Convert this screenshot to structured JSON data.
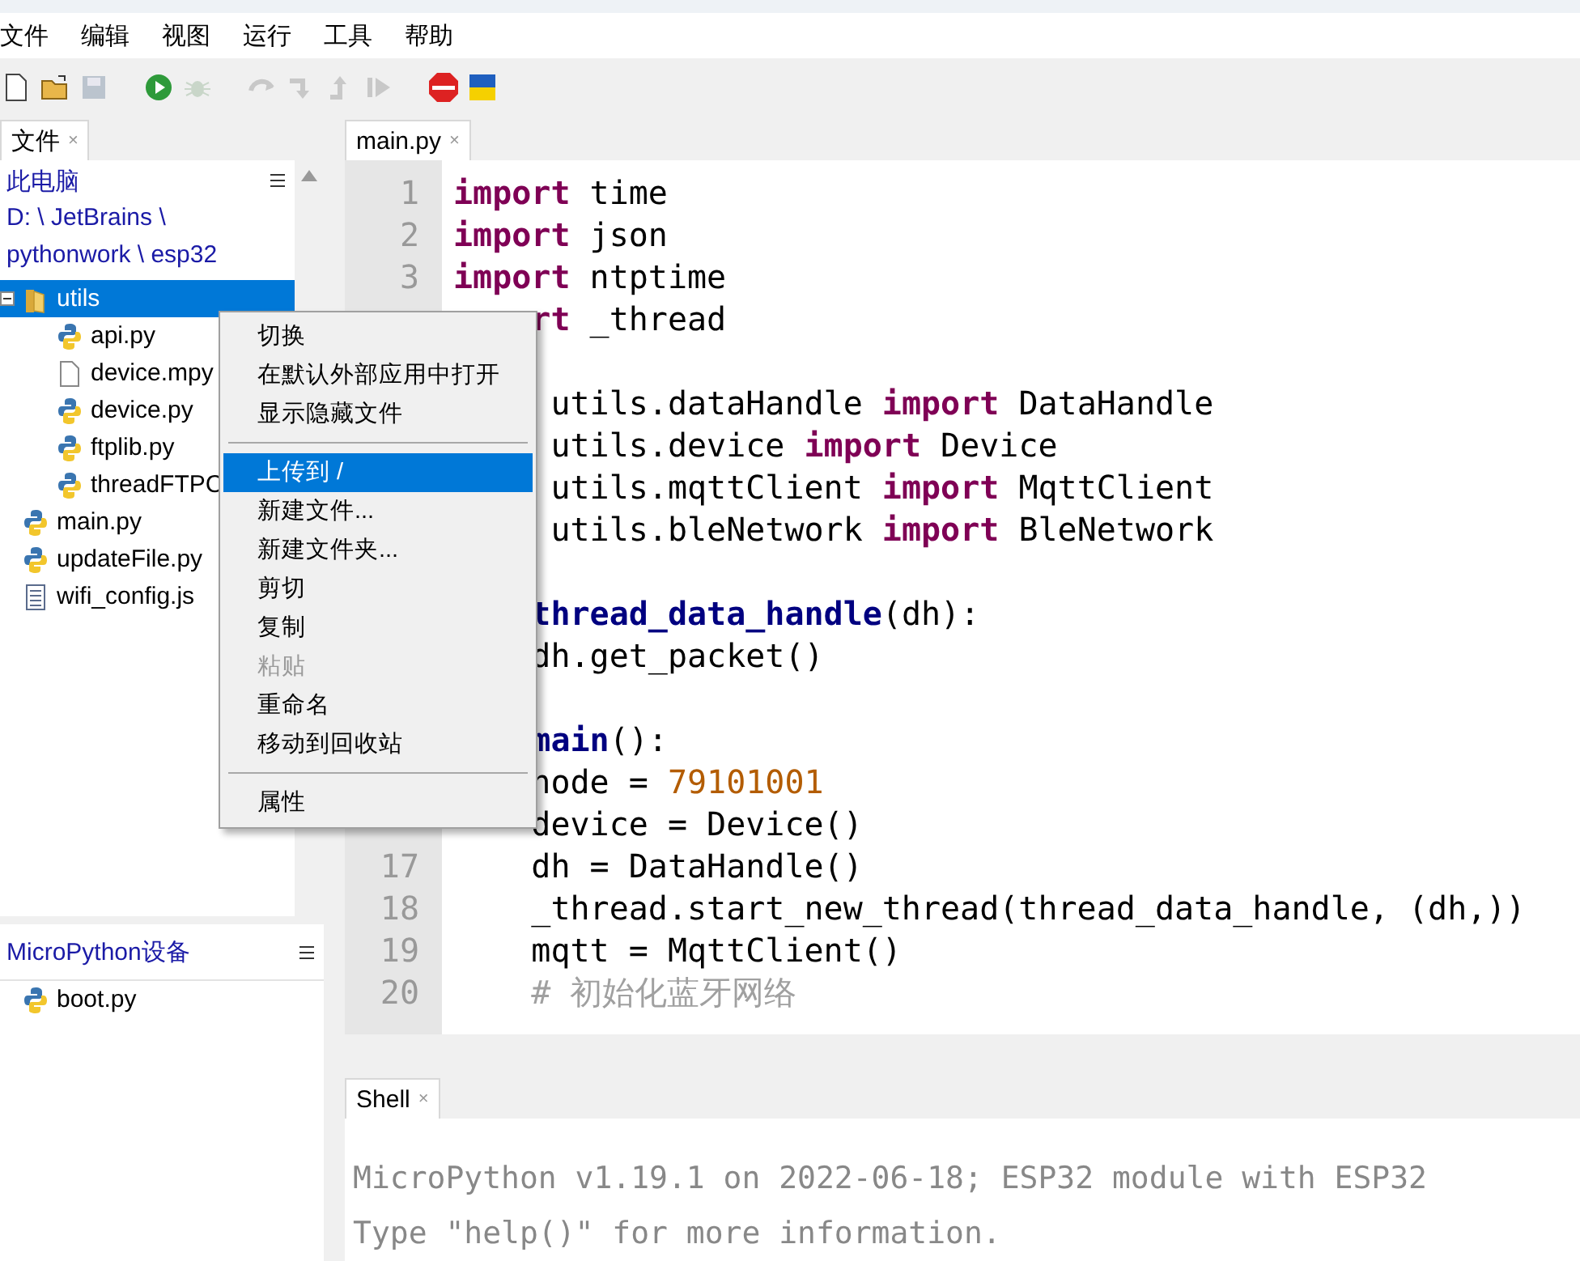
{
  "menu_bar": [
    "文件",
    "编辑",
    "视图",
    "运行",
    "工具",
    "帮助"
  ],
  "toolbar": [
    {
      "kind": "new",
      "disabled": false
    },
    {
      "kind": "open",
      "disabled": false
    },
    {
      "kind": "save",
      "disabled": true
    },
    {
      "kind": "run",
      "disabled": false
    },
    {
      "kind": "debug",
      "disabled": true
    },
    {
      "kind": "step-over",
      "disabled": true
    },
    {
      "kind": "step-into",
      "disabled": true
    },
    {
      "kind": "step-out",
      "disabled": true
    },
    {
      "kind": "resume",
      "disabled": true
    },
    {
      "kind": "stop",
      "disabled": false
    },
    {
      "kind": "flag",
      "disabled": false
    }
  ],
  "files_panel": {
    "tab": {
      "label": "文件",
      "close": "×"
    },
    "location": "此电脑",
    "path": "D: \\ JetBrains \\ pythonwork \\ esp32",
    "tree": [
      {
        "name": "utils",
        "kind": "folder",
        "expanded": true,
        "selected": true,
        "children": [
          {
            "name": "api.py",
            "kind": "python",
            "selected": false
          },
          {
            "name": "device.mpy",
            "kind": "file",
            "selected": false
          },
          {
            "name": "device.py",
            "kind": "python",
            "selected": false
          },
          {
            "name": "ftplib.py",
            "kind": "python",
            "selected": false
          },
          {
            "name": "threadFTPC",
            "kind": "python",
            "selected": false
          }
        ]
      },
      {
        "name": "main.py",
        "kind": "python",
        "selected": false
      },
      {
        "name": "updateFile.py",
        "kind": "python",
        "selected": false
      },
      {
        "name": "wifi_config.js",
        "kind": "text",
        "selected": false
      }
    ]
  },
  "device_panel": {
    "title": "MicroPython设备",
    "tree": [
      {
        "name": "boot.py",
        "kind": "python",
        "selected": false
      }
    ]
  },
  "editor": {
    "tab": {
      "label": "main.py",
      "close": "×"
    },
    "lines": [
      {
        "number": "1",
        "indented": false,
        "tokens": [
          {
            "kind": "keyword",
            "text": "import"
          },
          {
            "kind": "plain",
            "text": " time"
          }
        ]
      },
      {
        "number": "2",
        "indented": false,
        "tokens": [
          {
            "kind": "keyword",
            "text": "import"
          },
          {
            "kind": "plain",
            "text": " json"
          }
        ]
      },
      {
        "number": "3",
        "indented": false,
        "tokens": [
          {
            "kind": "keyword",
            "text": "import"
          },
          {
            "kind": "plain",
            "text": " ntptime"
          }
        ]
      },
      {
        "indented": true,
        "tokens": [
          {
            "kind": "keyword",
            "text": "rt"
          },
          {
            "kind": "plain",
            "text": " _thread"
          }
        ]
      },
      {
        "gap_before": true,
        "indented": true,
        "tokens": [
          {
            "kind": "plain",
            "text": " utils.dataHandle "
          },
          {
            "kind": "keyword",
            "text": "import"
          },
          {
            "kind": "plain",
            "text": " DataHandle"
          }
        ]
      },
      {
        "indented": true,
        "tokens": [
          {
            "kind": "plain",
            "text": " utils.device "
          },
          {
            "kind": "keyword",
            "text": "import"
          },
          {
            "kind": "plain",
            "text": " Device"
          }
        ]
      },
      {
        "indented": true,
        "tokens": [
          {
            "kind": "plain",
            "text": " utils.mqttClient "
          },
          {
            "kind": "keyword",
            "text": "import"
          },
          {
            "kind": "plain",
            "text": " MqttClient"
          }
        ]
      },
      {
        "indented": true,
        "tokens": [
          {
            "kind": "plain",
            "text": " utils.bleNetwork "
          },
          {
            "kind": "keyword",
            "text": "import"
          },
          {
            "kind": "plain",
            "text": " BleNetwork"
          }
        ]
      },
      {
        "gap_before": true,
        "indented": true,
        "tokens": [
          {
            "kind": "function",
            "text": "thread_data_handle"
          },
          {
            "kind": "plain",
            "text": "(dh):"
          }
        ]
      },
      {
        "indented": true,
        "tokens": [
          {
            "kind": "plain",
            "text": "dh.get_packet()"
          }
        ]
      },
      {
        "gap_before": true,
        "indented": true,
        "tokens": [
          {
            "kind": "function",
            "text": "main"
          },
          {
            "kind": "plain",
            "text": "():"
          }
        ]
      },
      {
        "indented": true,
        "tokens": [
          {
            "kind": "plain",
            "text": "node = "
          },
          {
            "kind": "number",
            "text": "79101001"
          }
        ]
      },
      {
        "indented": true,
        "tokens": [
          {
            "kind": "plain",
            "text": "device = Device()"
          }
        ]
      },
      {
        "number": "17",
        "indented": true,
        "tokens": [
          {
            "kind": "plain",
            "text": "dh = DataHandle()"
          }
        ]
      },
      {
        "number": "18",
        "indented": true,
        "tokens": [
          {
            "kind": "plain",
            "text": "_thread.start_new_thread(thread_data_handle, (dh,))"
          }
        ]
      },
      {
        "number": "19",
        "indented": true,
        "tokens": [
          {
            "kind": "plain",
            "text": "mqtt = MqttClient()"
          }
        ]
      },
      {
        "number": "20",
        "indented": true,
        "tokens": [
          {
            "kind": "comment",
            "text": "# 初始化蓝牙网络"
          }
        ]
      }
    ]
  },
  "shell": {
    "tab": {
      "label": "Shell",
      "close": "×"
    },
    "lines": [
      "MicroPython v1.19.1 on 2022-06-18; ESP32 module with ESP32",
      "Type \"help()\" for more information."
    ]
  },
  "context_menu": [
    {
      "kind": "item",
      "label": "切换",
      "selected": false,
      "disabled": false
    },
    {
      "kind": "item",
      "label": "在默认外部应用中打开",
      "selected": false,
      "disabled": false
    },
    {
      "kind": "item",
      "label": "显示隐藏文件",
      "selected": false,
      "disabled": false
    },
    {
      "kind": "separator"
    },
    {
      "kind": "item",
      "label": "上传到 /",
      "selected": true,
      "disabled": false
    },
    {
      "kind": "item",
      "label": "新建文件...",
      "selected": false,
      "disabled": false
    },
    {
      "kind": "item",
      "label": "新建文件夹...",
      "selected": false,
      "disabled": false
    },
    {
      "kind": "item",
      "label": "剪切",
      "selected": false,
      "disabled": false
    },
    {
      "kind": "item",
      "label": "复制",
      "selected": false,
      "disabled": false
    },
    {
      "kind": "item",
      "label": "粘贴",
      "selected": false,
      "disabled": true
    },
    {
      "kind": "item",
      "label": "重命名",
      "selected": false,
      "disabled": false
    },
    {
      "kind": "item",
      "label": "移动到回收站",
      "selected": false,
      "disabled": false
    },
    {
      "kind": "separator"
    },
    {
      "kind": "item",
      "label": "属性",
      "selected": false,
      "disabled": false
    }
  ]
}
